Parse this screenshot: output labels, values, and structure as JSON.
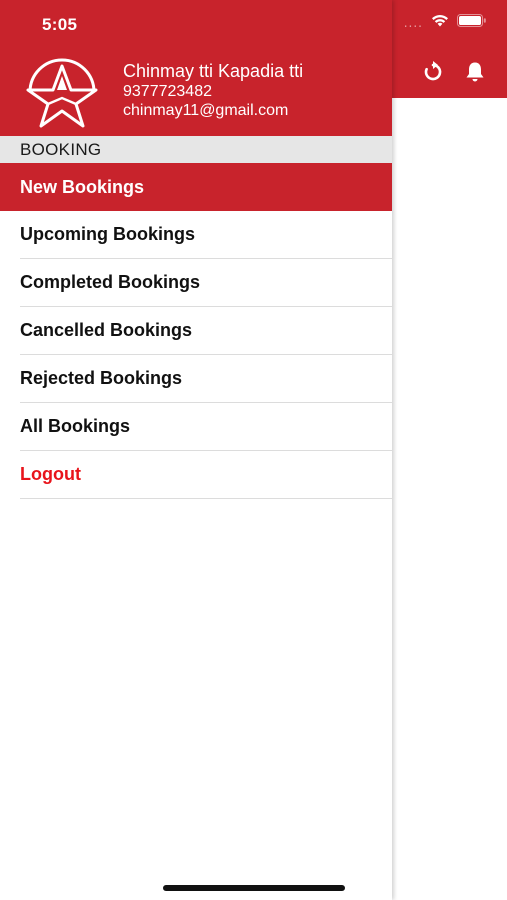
{
  "status_bar": {
    "time": "5:05",
    "signal": "...."
  },
  "profile": {
    "name": "Chinmay tti Kapadia tti",
    "phone": "9377723482",
    "email": "chinmay11@gmail.com"
  },
  "drawer": {
    "section_title": "BOOKING",
    "active_item": "New Bookings",
    "items": [
      {
        "label": "Upcoming Bookings"
      },
      {
        "label": "Completed Bookings"
      },
      {
        "label": "Cancelled Bookings"
      },
      {
        "label": "Rejected Bookings"
      },
      {
        "label": "All Bookings"
      },
      {
        "label": "Logout"
      }
    ]
  },
  "app_bar_icons": [
    "refresh-icon",
    "bell-icon"
  ],
  "colors": {
    "brand_red": "#c8232c",
    "logout_red": "#e8141b",
    "section_gray": "#e6e6e6"
  }
}
